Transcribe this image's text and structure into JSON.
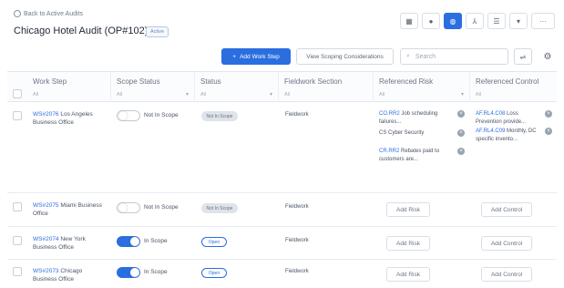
{
  "header": {
    "back_label": "Back to Active Audits",
    "title": "Chicago Hotel Audit (OP#102)",
    "status_badge": "Active"
  },
  "toolbar": {
    "add_button": "Add Work Step",
    "scoping_button": "View Scoping Considerations",
    "search_placeholder": "Search",
    "view_icons": [
      "grid-icon",
      "info-icon",
      "globe-icon",
      "hierarchy-icon",
      "list-icon",
      "chevron-down-icon",
      "more-icon"
    ]
  },
  "columns": [
    {
      "label": "Work Step",
      "filter": "All"
    },
    {
      "label": "Scope Status",
      "filter": "All"
    },
    {
      "label": "Status",
      "filter": "All"
    },
    {
      "label": "Fieldwork Section",
      "filter": "All"
    },
    {
      "label": "Referenced Risk",
      "filter": "All"
    },
    {
      "label": "Referenced Control",
      "filter": "All"
    }
  ],
  "rows": [
    {
      "id": "WS#2076",
      "name": "Los Angeles Business Office",
      "scope": "Not In Scope",
      "status": "Not In Scope",
      "fieldwork": "Fieldwork",
      "risks": [
        {
          "id": "CO.RR2",
          "text": "Job scheduling failures..."
        },
        {
          "id": "",
          "text": "CS Cyber Security"
        },
        {
          "id": "CR.RR2",
          "text": "Rebates paid to customers are..."
        }
      ],
      "controls": [
        {
          "id": "AF.RL4.C08",
          "text": "Loss Prevention provide..."
        },
        {
          "id": "AF.RL4.C09",
          "text": "Monthly, DC specific invento..."
        }
      ]
    },
    {
      "id": "WS#2075",
      "name": "Miami Business Office",
      "scope": "Not In Scope",
      "status": "Not In Scope",
      "fieldwork": "Fieldwork",
      "add_risk": "Add Risk",
      "add_control": "Add Control"
    },
    {
      "id": "WS#2074",
      "name": "New York Business Office",
      "scope": "In Scope",
      "status": "Open",
      "fieldwork": "Fieldwork",
      "add_risk": "Add Risk",
      "add_control": "Add Control"
    },
    {
      "id": "WS#2073",
      "name": "Chicago Business Office",
      "scope": "In Scope",
      "status": "Open",
      "fieldwork": "Fieldwork",
      "add_risk": "Add Risk",
      "add_control": "Add Control"
    }
  ],
  "colors": {
    "accent": "#2a6ee0",
    "pill_grey": "#dfe3ea"
  }
}
